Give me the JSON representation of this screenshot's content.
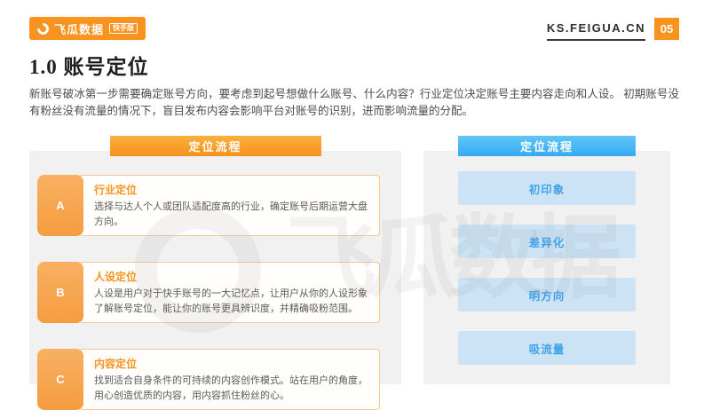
{
  "header": {
    "logo": {
      "brand": "飞瓜数据",
      "badge": "快手版"
    },
    "site": "KS.FEIGUA.CN",
    "page_number": "05"
  },
  "title": "1.0 账号定位",
  "intro": "新账号破冰第一步需要确定账号方向，要考虑到起号想做什么账号、什么内容？行业定位决定账号主要内容走向和人设。 初期账号没有粉丝没有流量的情况下，盲目发布内容会影响平台对账号的识别，进而影响流量的分配。",
  "left_panel": {
    "header": "定位流程",
    "items": [
      {
        "key": "A",
        "title": "行业定位",
        "desc": "选择与达人个人或团队适配度高的行业，确定账号后期运营大盘方向。"
      },
      {
        "key": "B",
        "title": "人设定位",
        "desc": "人设是用户对于快手账号的一大记忆点，让用户从你的人设形象了解账号定位，能让你的账号更具辨识度，并精确吸粉范围。"
      },
      {
        "key": "C",
        "title": "内容定位",
        "desc": "找到适合自身条件的可持续的内容创作模式。站在用户的角度，用心创造优质的内容，用内容抓住粉丝的心。"
      }
    ]
  },
  "right_panel": {
    "header": "定位流程",
    "steps": [
      "初印象",
      "差异化",
      "明方向",
      "吸流量"
    ]
  },
  "watermark": {
    "text": "飞瓜数据"
  },
  "colors": {
    "brand_orange": "#F7931E",
    "orange_light": "#FBAE3F",
    "card_border": "#F6C693",
    "blue": "#36A9F1",
    "blue_light": "#CBE3F4",
    "panel_gray": "#F1F1F2",
    "text_dark": "#2e2e2e"
  }
}
